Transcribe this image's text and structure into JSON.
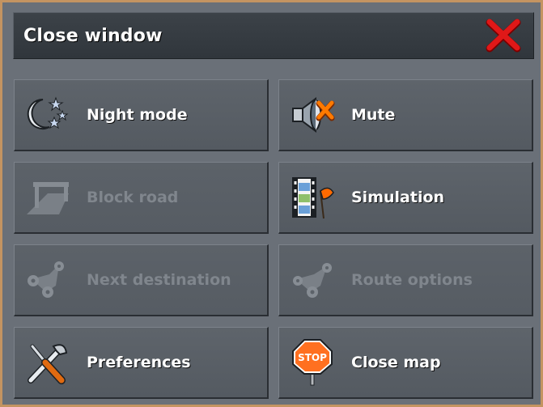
{
  "header": {
    "title": "Close window",
    "close_icon": "red-x-icon"
  },
  "buttons": [
    {
      "label": "Night mode",
      "icon": "moon-stars-icon",
      "enabled": true
    },
    {
      "label": "Mute",
      "icon": "speaker-mute-icon",
      "enabled": true
    },
    {
      "label": "Block road",
      "icon": "road-barrier-icon",
      "enabled": false
    },
    {
      "label": "Simulation",
      "icon": "film-flag-icon",
      "enabled": true
    },
    {
      "label": "Next destination",
      "icon": "route-nodes-icon",
      "enabled": false
    },
    {
      "label": "Route options",
      "icon": "route-nodes-icon",
      "enabled": false
    },
    {
      "label": "Preferences",
      "icon": "wrench-screwdriver-icon",
      "enabled": true
    },
    {
      "label": "Close map",
      "icon": "stop-sign-icon",
      "enabled": true
    }
  ],
  "stop_sign_text": "STOP",
  "colors": {
    "frame_border": "#c49461",
    "panel_bg": "#6a7078",
    "header_bg": "#353b41",
    "button_bg": "#5a6067",
    "label_enabled": "#ffffff",
    "label_disabled": "#80868d",
    "close_red": "#e01818"
  }
}
